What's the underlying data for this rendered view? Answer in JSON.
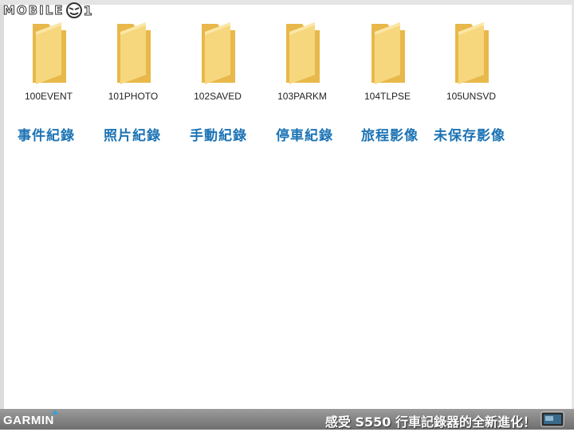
{
  "header": {
    "logo_text": "MOBILE",
    "logo_suffix": "1"
  },
  "folders": [
    {
      "name": "100EVENT",
      "caption": "事件紀錄"
    },
    {
      "name": "101PHOTO",
      "caption": "照片紀錄"
    },
    {
      "name": "102SAVED",
      "caption": "手動紀錄"
    },
    {
      "name": "103PARKM",
      "caption": "停車紀錄"
    },
    {
      "name": "104TLPSE",
      "caption": "旅程影像"
    },
    {
      "name": "105UNSVD",
      "caption": "未保存影像"
    }
  ],
  "footer": {
    "brand": "GARMIN",
    "slogan": "感受 S550 行車記錄器的全新進化！"
  },
  "colors": {
    "caption": "#1c73b5",
    "folder_body": "#f6d77e",
    "folder_back": "#e8b84a",
    "garmin_accent": "#3aa0d8"
  },
  "icons": {
    "folder": "folder-icon",
    "logo_face": "logo-face-icon",
    "device": "dashcam-device-icon"
  }
}
